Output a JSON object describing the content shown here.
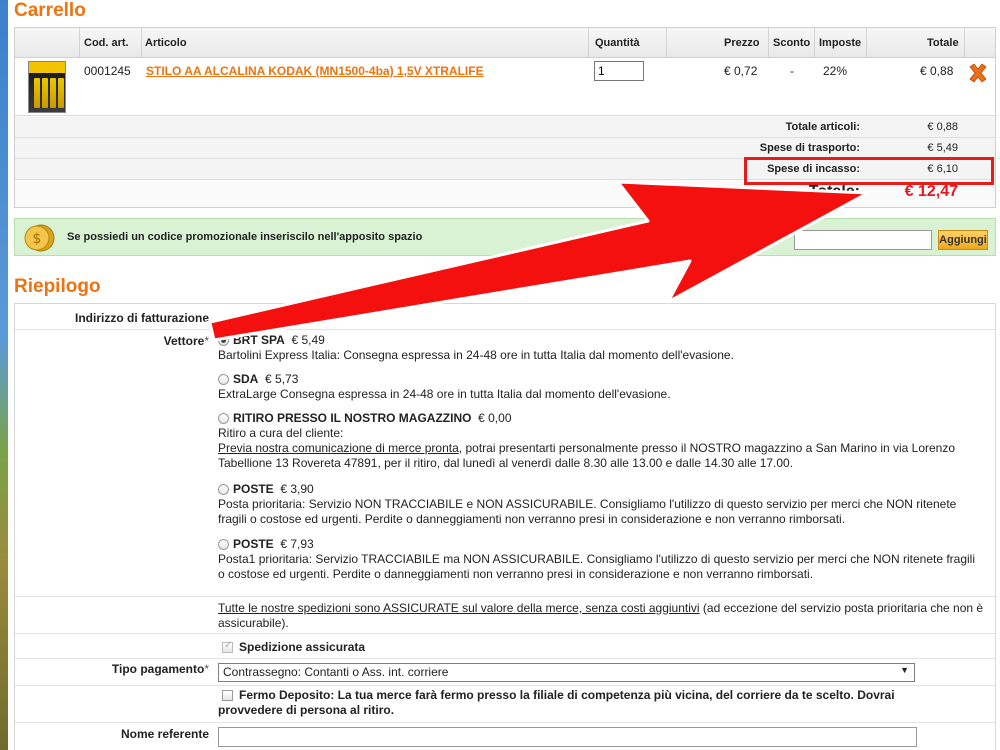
{
  "cart": {
    "title": "Carrello",
    "columns": {
      "code": "Cod. art.",
      "article": "Articolo",
      "quantity": "Quantità",
      "price": "Prezzo",
      "discount": "Sconto",
      "tax": "Imposte",
      "total": "Totale"
    },
    "item": {
      "code": "0001245",
      "name": "STILO AA ALCALINA KODAK (MN1500-4ba) 1,5V XTRALIFE",
      "quantity": "1",
      "price": "€ 0,72",
      "discount": "-",
      "tax": "22%",
      "total": "€ 0,88"
    },
    "summary": {
      "items_label": "Totale articoli:",
      "items_value": "€ 0,88",
      "shipping_label": "Spese di trasporto:",
      "shipping_value": "€ 5,49",
      "cod_label": "Spese di incasso:",
      "cod_value": "€ 6,10",
      "total_label": "Totale:",
      "total_value": "€ 12,47"
    },
    "highlight_color": "#e81a1a"
  },
  "promo": {
    "text": "Se possiedi un codice promozionale inseriscilo nell'apposito spazio",
    "input_value": "",
    "apply_label": "Aggiungi"
  },
  "summary": {
    "title": "Riepilogo",
    "billing_label": "Indirizzo di fatturazione",
    "carrier_label": "Vettore",
    "required_mark": "*",
    "carriers": [
      {
        "name": "BRT SPA",
        "price": "€ 5,49",
        "desc": "Bartolini Express Italia: Consegna espressa in 24-48 ore in tutta Italia dal momento dell'evasione.",
        "selected": true
      },
      {
        "name": "SDA",
        "price": "€ 5,73",
        "desc": "ExtraLarge Consegna espressa in 24-48 ore in tutta Italia dal momento dell'evasione.",
        "selected": false
      },
      {
        "name": "RITIRO PRESSO IL NOSTRO MAGAZZINO",
        "price": "€ 0,00",
        "desc_line1": "Ritiro a cura del cliente:",
        "desc_link": "Previa nostra comunicazione di merce pronta",
        "desc_rest": ", potrai presentarti personalmente presso il NOSTRO magazzino a San Marino in via Lorenzo Tabellione 13 Rovereta 47891, per il ritiro, dal lunedì al venerdì dalle 8.30 alle 13.00 e dalle 14.30 alle 17.00.",
        "selected": false
      },
      {
        "name": "POSTE",
        "price": "€ 3,90",
        "desc": "Posta prioritaria: Servizio NON TRACCIABILE e NON ASSICURABILE. Consigliamo l'utilizzo di questo servizio per merci che NON ritenete fragili o costose ed urgenti. Perdite o danneggiamenti non verranno presi in considerazione e non verranno rimborsati.",
        "selected": false
      },
      {
        "name": "POSTE",
        "price": "€ 7,93",
        "desc": "Posta1 prioritaria: Servizio TRACCIABILE ma NON ASSICURABILE. Consigliamo l'utilizzo di questo servizio per merci che NON ritenete fragili o costose ed urgenti. Perdite o danneggiamenti non verranno presi in considerazione e non verranno rimborsati.",
        "selected": false
      }
    ],
    "insured_note_link": "Tutte le nostre spedizioni sono ASSICURATE sul valore della merce, senza costi aggiuntivi",
    "insured_note_rest": " (ad eccezione del servizio posta prioritaria che non è assicurabile).",
    "insured_checkbox_label": "Spedizione assicurata",
    "payment_label": "Tipo pagamento",
    "payment_selected": "Contrassegno: Contanti o Ass. int. corriere",
    "depot_label": "Fermo Deposito: La tua merce farà fermo presso la filiale di competenza più vicina, del corriere da te scelto. Dovrai provvedere di persona al ritiro.",
    "referent_label": "Nome referente",
    "referent_value": ""
  }
}
